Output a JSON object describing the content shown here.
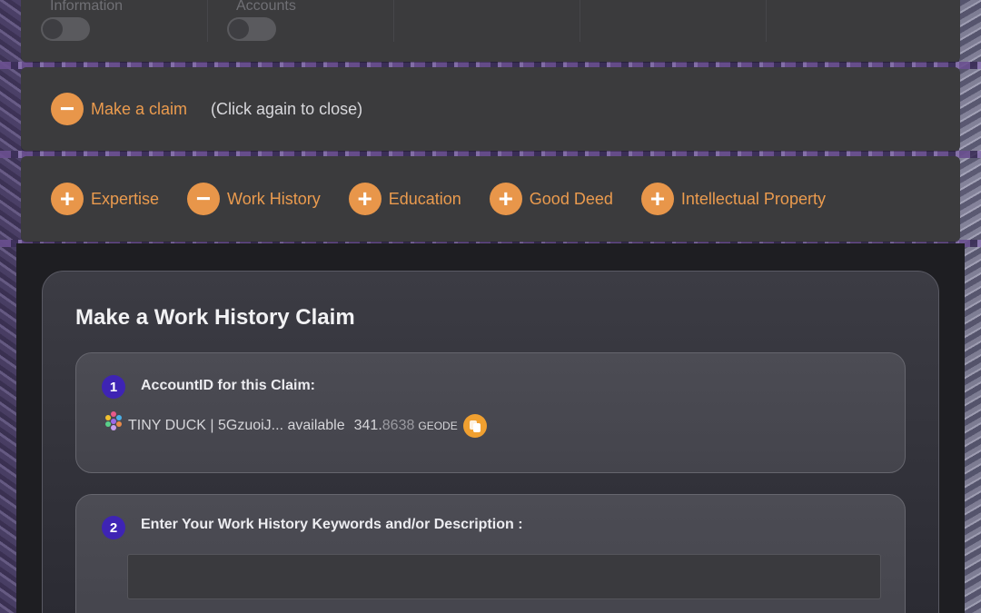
{
  "toggles": [
    {
      "label": "Information",
      "state": "off"
    },
    {
      "label": "Accounts",
      "state": "off"
    }
  ],
  "claim_toggle": {
    "icon": "minus-icon",
    "label": "Make a claim",
    "hint": "(Click again to close)"
  },
  "categories": [
    {
      "label": "Expertise",
      "icon": "plus-icon"
    },
    {
      "label": "Work History",
      "icon": "minus-icon"
    },
    {
      "label": "Education",
      "icon": "plus-icon"
    },
    {
      "label": "Good Deed",
      "icon": "plus-icon"
    },
    {
      "label": "Intellectual Property",
      "icon": "plus-icon"
    }
  ],
  "form": {
    "title": "Make a Work History Claim",
    "step1": {
      "number": "1",
      "label": "AccountID for this Claim:",
      "account_name": "TINY DUCK | 5GzuoiJ... available",
      "balance_int": "341.",
      "balance_dec": "8638",
      "unit": "GEODE"
    },
    "step2": {
      "number": "2",
      "label": "Enter Your Work History Keywords and/or Description :",
      "input_value": ""
    }
  },
  "colors": {
    "accent": "#e8964a",
    "step_badge": "#3e24b4",
    "copy_button": "#f0a030"
  }
}
